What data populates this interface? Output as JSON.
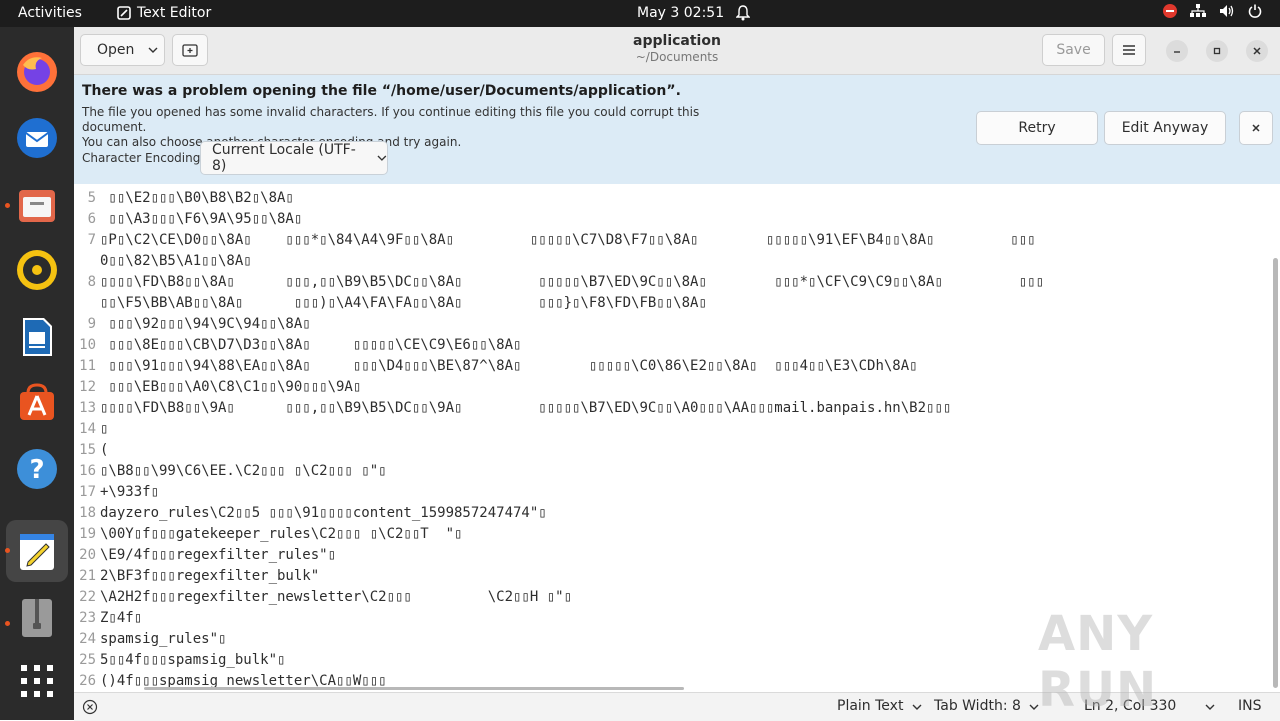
{
  "topbar": {
    "activities": "Activities",
    "app_name": "Text Editor",
    "clock": "May 3  02:51"
  },
  "header": {
    "open_label": "Open",
    "title": "application",
    "subtitle": "~/Documents",
    "save_label": "Save"
  },
  "infobar": {
    "title": "There was a problem opening the file “/home/user/Documents/application”.",
    "message_line1": "The file you opened has some invalid characters. If you continue editing this file you could corrupt this document.",
    "message_line2": "You can also choose another character encoding and try again.",
    "encoding_label": "Character Encoding:",
    "encoding_value": "Current Locale (UTF-8)",
    "retry_label": "Retry",
    "edit_anyway_label": "Edit Anyway"
  },
  "editor": {
    "lines": [
      {
        "n": "5",
        "t": " ▯▯\\E2▯▯▯\\B0\\B8\\B2▯\\8A▯"
      },
      {
        "n": "6",
        "t": " ▯▯\\A3▯▯▯\\F6\\9A\\95▯▯\\8A▯"
      },
      {
        "n": "7",
        "t": "▯P▯\\C2\\CE\\D0▯▯\\8A▯    ▯▯▯*▯\\84\\A4\\9F▯▯\\8A▯         ▯▯▯▯▯\\C7\\D8\\F7▯▯\\8A▯        ▯▯▯▯▯\\91\\EF\\B4▯▯\\8A▯         ▯▯▯"
      },
      {
        "n": "",
        "t": "0▯▯\\82\\B5\\A1▯▯\\8A▯"
      },
      {
        "n": "8",
        "t": "▯▯▯▯\\FD\\B8▯▯\\8A▯      ▯▯▯,▯▯\\B9\\B5\\DC▯▯\\8A▯         ▯▯▯▯▯\\B7\\ED\\9C▯▯\\8A▯        ▯▯▯*▯\\CF\\C9\\C9▯▯\\8A▯         ▯▯▯"
      },
      {
        "n": "",
        "t": "▯▯\\F5\\BB\\AB▯▯\\8A▯      ▯▯▯)▯\\A4\\FA\\FA▯▯\\8A▯         ▯▯▯}▯\\F8\\FD\\FB▯▯\\8A▯"
      },
      {
        "n": "9",
        "t": " ▯▯▯\\92▯▯▯\\94\\9C\\94▯▯\\8A▯"
      },
      {
        "n": "10",
        "t": " ▯▯▯\\8E▯▯▯\\CB\\D7\\D3▯▯\\8A▯     ▯▯▯▯▯\\CE\\C9\\E6▯▯\\8A▯"
      },
      {
        "n": "11",
        "t": " ▯▯▯\\91▯▯▯\\94\\88\\EA▯▯\\8A▯     ▯▯▯\\D4▯▯▯\\BE\\87^\\8A▯        ▯▯▯▯▯\\C0\\86\\E2▯▯\\8A▯  ▯▯▯4▯▯\\E3\\CDh\\8A▯"
      },
      {
        "n": "12",
        "t": " ▯▯▯\\EB▯▯▯\\A0\\C8\\C1▯▯\\90▯▯▯\\9A▯"
      },
      {
        "n": "13",
        "t": "▯▯▯▯\\FD\\B8▯▯\\9A▯      ▯▯▯,▯▯\\B9\\B5\\DC▯▯\\9A▯         ▯▯▯▯▯\\B7\\ED\\9C▯▯\\A0▯▯▯\\AA▯▯▯mail.banpais.hn\\B2▯▯▯"
      },
      {
        "n": "14",
        "t": "▯"
      },
      {
        "n": "15",
        "t": "("
      },
      {
        "n": "16",
        "t": "▯\\B8▯▯\\99\\C6\\EE.\\C2▯▯▯ ▯\\C2▯▯▯ ▯\"▯"
      },
      {
        "n": "17",
        "t": "+\\933f▯"
      },
      {
        "n": "18",
        "t": "dayzero_rules\\C2▯▯5 ▯▯▯\\91▯▯▯▯content_1599857247474\"▯"
      },
      {
        "n": "19",
        "t": "\\00Y▯f▯▯▯gatekeeper_rules\\C2▯▯▯ ▯\\C2▯▯T  \"▯"
      },
      {
        "n": "20",
        "t": "\\E9/4f▯▯▯regexfilter_rules\"▯"
      },
      {
        "n": "21",
        "t": "2\\BF3f▯▯▯regexfilter_bulk\""
      },
      {
        "n": "22",
        "t": "\\A2H2f▯▯▯regexfilter_newsletter\\C2▯▯▯         \\C2▯▯H ▯\"▯"
      },
      {
        "n": "23",
        "t": "Z▯4f▯"
      },
      {
        "n": "24",
        "t": "spamsig_rules\"▯"
      },
      {
        "n": "25",
        "t": "5▯▯4f▯▯▯spamsig_bulk\"▯"
      },
      {
        "n": "26",
        "t": "()4f▯▯▯spamsig_newsletter\\CA▯▯W▯▯▯"
      }
    ]
  },
  "statusbar": {
    "language": "Plain Text",
    "tab_width": "Tab Width: 8",
    "position": "Ln 2, Col 330",
    "mode": "INS"
  },
  "watermark": "ANY RUN"
}
